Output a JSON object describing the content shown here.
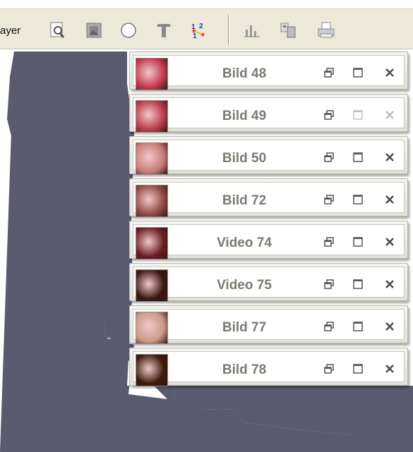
{
  "toolbar": {
    "label_partial": "ayer",
    "icons": [
      "preview-icon",
      "image-edit-icon",
      "circle-icon",
      "text-icon",
      "numbering-icon",
      "chart-icon",
      "copy-icon",
      "print-icon"
    ]
  },
  "panels": [
    {
      "title": "Bild 48",
      "thumb_color": "#c4394e",
      "max_enabled": true,
      "close_enabled": true
    },
    {
      "title": "Bild 49",
      "thumb_color": "#b83b4a",
      "max_enabled": false,
      "close_enabled": false
    },
    {
      "title": "Bild 50",
      "thumb_color": "#c97b76",
      "max_enabled": true,
      "close_enabled": true
    },
    {
      "title": "Bild 72",
      "thumb_color": "#8f4b44",
      "max_enabled": true,
      "close_enabled": true
    },
    {
      "title": "Video 74",
      "thumb_color": "#6a1d22",
      "max_enabled": true,
      "close_enabled": true
    },
    {
      "title": "Video 75",
      "thumb_color": "#3a1610",
      "max_enabled": true,
      "close_enabled": true
    },
    {
      "title": "Bild 77",
      "thumb_color": "#c99a86",
      "max_enabled": true,
      "close_enabled": true
    },
    {
      "title": "Bild 78",
      "thumb_color": "#3b1a0a",
      "max_enabled": true,
      "close_enabled": true
    }
  ],
  "colors": {
    "backdrop": "#5a5a70",
    "toolbar": "#ece9d8"
  }
}
